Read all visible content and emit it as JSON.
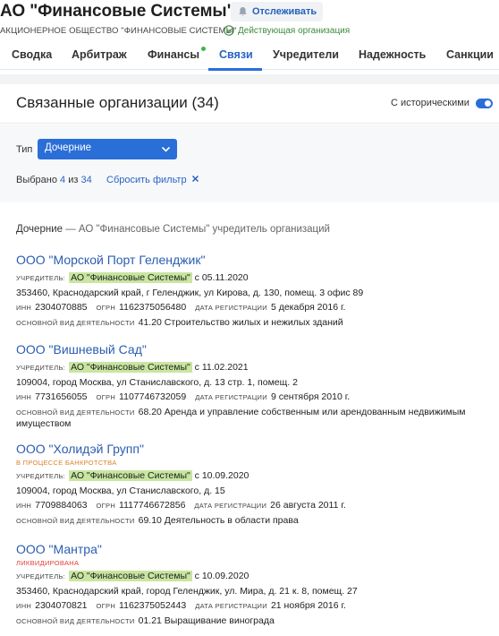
{
  "company": {
    "title": "АО \"Финансовые Системы\"",
    "subtitle": "АКЦИОНЕРНОЕ ОБЩЕСТВО \"ФИНАНСОВЫЕ СИСТЕМЫ\"",
    "track_label": "Отслеживать",
    "status": "Действующая организация"
  },
  "tabs": [
    {
      "label": "Сводка"
    },
    {
      "label": "Арбитраж"
    },
    {
      "label": "Финансы"
    },
    {
      "label": "Связи",
      "active": true
    },
    {
      "label": "Учредители"
    },
    {
      "label": "Надежность"
    },
    {
      "label": "Санкции"
    }
  ],
  "section": {
    "title": "Связанные организации (34)",
    "historical_label": "С историческими",
    "historical_enabled": true
  },
  "filter": {
    "type_label": "Тип",
    "type_value": "Дочерние",
    "selected_prefix": "Выбрано",
    "selected_count": "4",
    "selected_of": "из",
    "total_count": "34",
    "reset_label": "Сбросить фильтр"
  },
  "subsidiaries": {
    "heading": "Дочерние",
    "description": " — АО \"Финансовые Системы\" учредитель организаций"
  },
  "labels": {
    "founder": "УЧРЕДИТЕЛЬ:",
    "inn": "ИНН",
    "ogrn": "ОГРН",
    "reg_date": "ДАТА РЕГИСТРАЦИИ",
    "activity": "ОСНОВНОЙ ВИД ДЕЯТЕЛЬНОСТИ"
  },
  "organizations": [
    {
      "name": "ООО \"Морской Порт Геленджик\"",
      "status": "",
      "founder": "АО \"Финансовые Системы\"",
      "founder_since": "с 05.11.2020",
      "address": "353460, Краснодарский край, г Геленджик, ул Кирова, д. 130, помещ. 3 офис 89",
      "inn": "2304070885",
      "ogrn": "1162375056480",
      "reg_date": "5 декабря 2016 г.",
      "activity": "41.20 Строительство жилых и нежилых зданий"
    },
    {
      "name": "ООО \"Вишневый Сад\"",
      "status": "",
      "founder": "АО \"Финансовые Системы\"",
      "founder_since": "с 11.02.2021",
      "address": "109004, город Москва, ул Станиславского, д. 13 стр. 1, помещ. 2",
      "inn": "7731656055",
      "ogrn": "1107746732059",
      "reg_date": "9 сентября 2010 г.",
      "activity": "68.20 Аренда и управление собственным или арендованным недвижимым имуществом"
    },
    {
      "name": "ООО \"Холидэй Групп\"",
      "status": "В ПРОЦЕССЕ БАНКРОТСТВА",
      "founder": "АО \"Финансовые Системы\"",
      "founder_since": "с 10.09.2020",
      "address": "109004, город Москва, ул Станиславского, д. 15",
      "inn": "7709884063",
      "ogrn": "1117746672856",
      "reg_date": "26 августа 2011 г.",
      "activity": "69.10 Деятельность в области права"
    },
    {
      "name": "ООО \"Мантра\"",
      "status": "ЛИКВИДИРОВАНА",
      "founder": "АО \"Финансовые Системы\"",
      "founder_since": "с 10.09.2020",
      "address": "353460, Краснодарский край, город Геленджик, ул. Мира, д. 21 к. 8, помещ. 27",
      "inn": "2304070821",
      "ogrn": "1162375052443",
      "reg_date": "21 ноября 2016 г.",
      "activity": "01.21 Выращивание винограда"
    }
  ],
  "colors": {
    "accent": "#2a6ed8",
    "link": "#2a5db0",
    "highlight": "#c8e6a0",
    "bankrupt": "#d9822b",
    "liquidated": "#e0403a",
    "active_status": "#3c8a3c"
  }
}
